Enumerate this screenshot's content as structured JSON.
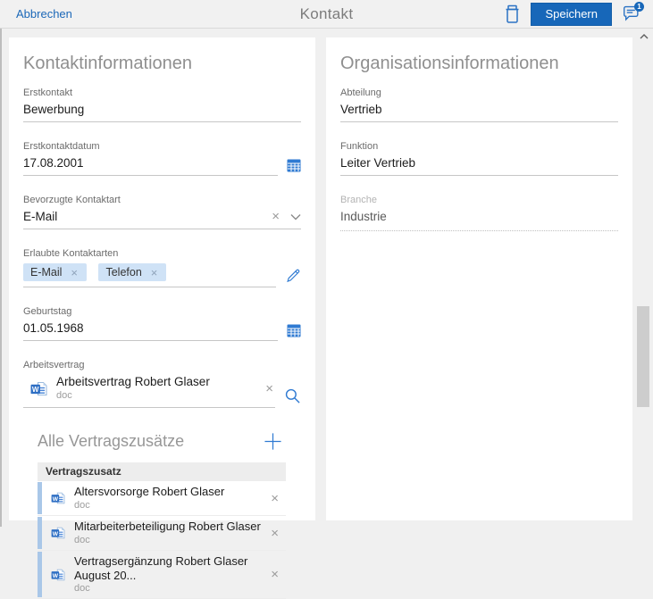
{
  "icons": {
    "close": "×"
  },
  "topbar": {
    "cancel_label": "Abbrechen",
    "title": "Kontakt",
    "save_label": "Speichern",
    "notification_badge": "1"
  },
  "contact": {
    "section_title": "Kontaktinformationen",
    "erstkontakt": {
      "label": "Erstkontakt",
      "value": "Bewerbung"
    },
    "erstkontaktdatum": {
      "label": "Erstkontaktdatum",
      "value": "17.08.2001"
    },
    "bevorzugte_kontaktart": {
      "label": "Bevorzugte Kontaktart",
      "value": "E-Mail"
    },
    "erlaubte_kontaktarten": {
      "label": "Erlaubte Kontaktarten",
      "chips": [
        {
          "label": "E-Mail"
        },
        {
          "label": "Telefon"
        }
      ]
    },
    "geburtstag": {
      "label": "Geburtstag",
      "value": "01.05.1968"
    },
    "arbeitsvertrag": {
      "label": "Arbeitsvertrag",
      "file_title": "Arbeitsvertrag Robert Glaser",
      "file_type": "doc"
    }
  },
  "attachments": {
    "section_title": "Alle Vertragszusätze",
    "column_header": "Vertragszusatz",
    "rows": [
      {
        "title": "Altersvorsorge Robert Glaser",
        "type": "doc"
      },
      {
        "title": "Mitarbeiterbeteiligung Robert Glaser",
        "type": "doc"
      },
      {
        "title": "Vertragsergänzung Robert Glaser August 20...",
        "type": "doc"
      }
    ]
  },
  "organisation": {
    "section_title": "Organisationsinformationen",
    "abteilung": {
      "label": "Abteilung",
      "value": "Vertrieb"
    },
    "funktion": {
      "label": "Funktion",
      "value": "Leiter Vertrieb"
    },
    "branche": {
      "label": "Branche",
      "value": "Industrie"
    }
  },
  "colors": {
    "accent_blue": "#2a72c4",
    "button_blue": "#1767b9",
    "chip_blue": "#cfe2f6",
    "row_accent": "#a9c7e8"
  }
}
